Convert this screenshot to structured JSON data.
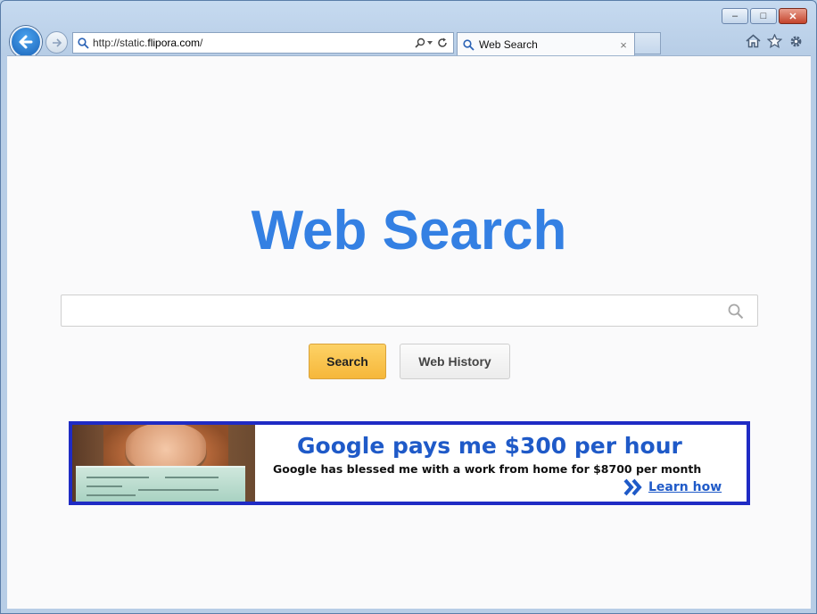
{
  "browser": {
    "address": {
      "prefix": "http://static.",
      "domain": "flipora.com",
      "suffix": "/"
    },
    "tab": {
      "title": "Web Search",
      "close": "×"
    },
    "window_controls": {
      "minimize": "–",
      "maximize": "□",
      "close": "✕"
    },
    "icons": [
      "back-icon",
      "forward-icon",
      "search-icon",
      "refresh-icon",
      "home-icon",
      "favorites-star-icon",
      "settings-gear-icon"
    ]
  },
  "page": {
    "title": "Web Search",
    "search": {
      "value": "",
      "placeholder": ""
    },
    "buttons": {
      "search": "Search",
      "history": "Web History"
    }
  },
  "ad": {
    "headline": "Google pays me $300 per hour",
    "subline": "Google has blessed me with a work from home for $8700 per month",
    "cta": "Learn how"
  },
  "colors": {
    "title": "#3480e3",
    "search_button": "#f6b73a",
    "ad_border": "#1f2bc4",
    "ad_text": "#1f5ac8"
  }
}
